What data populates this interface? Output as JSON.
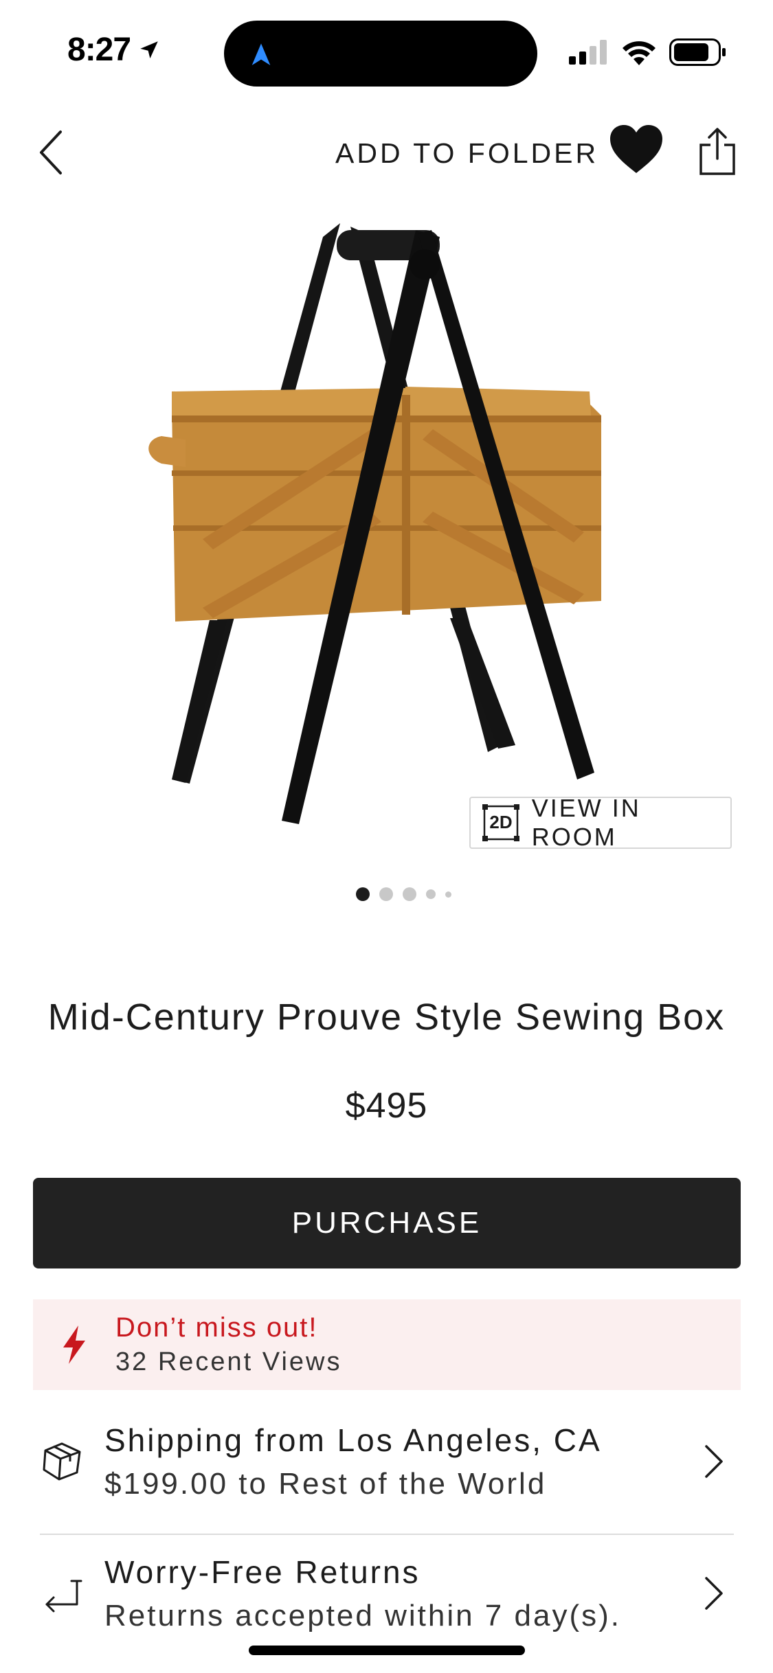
{
  "status_bar": {
    "time": "8:27",
    "icons": [
      "location-arrow-icon",
      "signal-icon",
      "wifi-icon",
      "battery-icon"
    ]
  },
  "top_bar": {
    "add_to_folder": "ADD TO FOLDER"
  },
  "image": {
    "view_in_room_badge": "2D",
    "view_in_room": "VIEW IN ROOM",
    "carousel_pages": 5,
    "carousel_active": 1
  },
  "product": {
    "title": "Mid-Century Prouve Style Sewing Box",
    "price": "$495"
  },
  "purchase_label": "PURCHASE",
  "alert": {
    "headline": "Don’t miss out!",
    "views": "32 Recent Views",
    "color": "#c8181e"
  },
  "shipping": {
    "title": "Shipping from Los Angeles, CA",
    "detail": "$199.00 to Rest of the World"
  },
  "returns": {
    "title": "Worry-Free Returns",
    "detail": "Returns accepted within 7 day(s)."
  }
}
